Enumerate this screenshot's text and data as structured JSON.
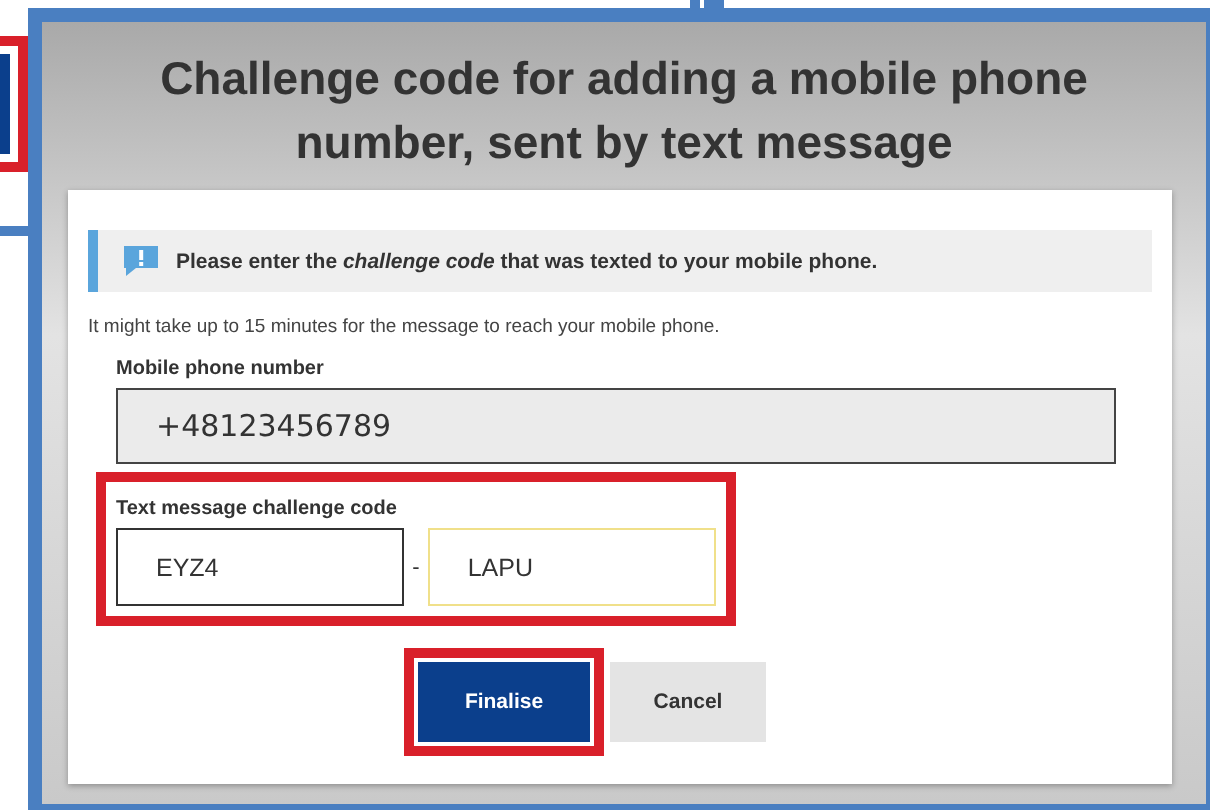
{
  "title": "Challenge code for adding a mobile phone number, sent by text message",
  "notice": {
    "text": "Please enter the *challenge code* that was texted to your mobile phone."
  },
  "hint": "It might take up to 15 minutes for the message to reach your mobile phone.",
  "phone": {
    "label": "Mobile phone number",
    "value": "+48123456789",
    "disabled": true
  },
  "code": {
    "label": "Text message challenge code",
    "separator": "-",
    "highlighted": true,
    "parts": [
      {
        "value": "EYZ4",
        "focused": false
      },
      {
        "value": "LAPU",
        "focused": true
      }
    ]
  },
  "buttons": [
    {
      "label": "Finalise",
      "kind": "primary",
      "highlighted": true
    },
    {
      "label": "Cancel",
      "kind": "secondary",
      "highlighted": false
    }
  ]
}
